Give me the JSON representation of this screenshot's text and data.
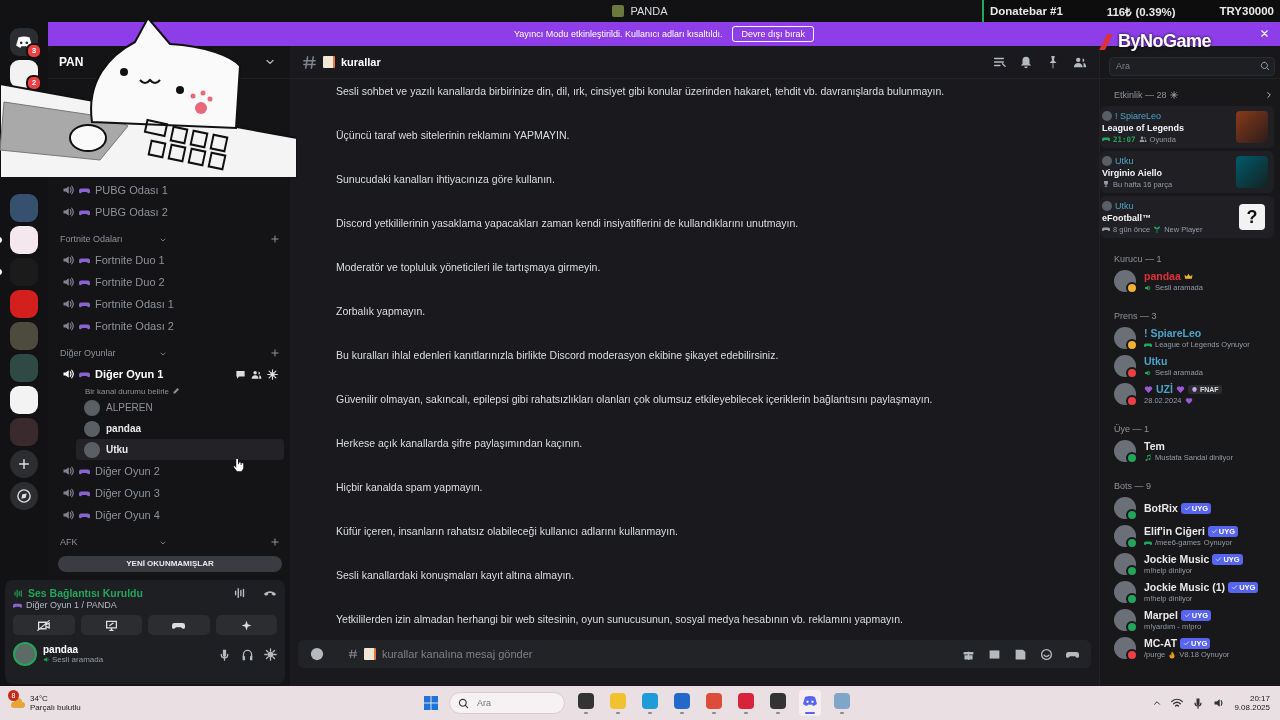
{
  "title_bar": {
    "title": "PANDA"
  },
  "donate_overlay": {
    "label": "Donatebar #1",
    "amount": "116₺ (0.39%)",
    "goal": "TRY30000"
  },
  "logo_overlay": {
    "text": "ByNoGame"
  },
  "banner": {
    "message": "Yayıncı Modu etkinleştirildi. Kullanıcı adları kısaltıldı.",
    "button": "Devre dışı bırak"
  },
  "servers": [
    {
      "kind": "home",
      "badge": "3",
      "unread": false
    },
    {
      "kind": "server",
      "badge": "2",
      "unread": false
    },
    {
      "kind": "gap"
    },
    {
      "kind": "server",
      "unread": false
    },
    {
      "kind": "server",
      "unread": true
    },
    {
      "kind": "server",
      "unread": true
    },
    {
      "kind": "server",
      "unread": false
    },
    {
      "kind": "server",
      "unread": false
    },
    {
      "kind": "server",
      "unread": false
    },
    {
      "kind": "server",
      "unread": false
    },
    {
      "kind": "server",
      "unread": false
    },
    {
      "kind": "add"
    },
    {
      "kind": "discover"
    }
  ],
  "sidebar": {
    "server_name": "PAN",
    "channels": [
      {
        "kind": "voice",
        "name": "PUBG Odası 1",
        "active": false
      },
      {
        "kind": "voice",
        "name": "PUBG Odası 2",
        "active": false
      },
      {
        "kind": "category",
        "name": "Fortnite Odaları",
        "children": [
          {
            "kind": "voice",
            "name": "Fortnite Duo 1",
            "active": false
          },
          {
            "kind": "voice",
            "name": "Fortnite Duo 2",
            "active": false
          },
          {
            "kind": "voice",
            "name": "Fortnite Odası 1",
            "active": false
          },
          {
            "kind": "voice",
            "name": "Fortnite Odası 2",
            "active": false
          }
        ]
      },
      {
        "kind": "category",
        "name": "Diğer Oyunlar",
        "children": [
          {
            "kind": "voice",
            "name": "Diğer Oyun 1",
            "active": true,
            "status": "Bir kanal durumu belirle",
            "users": [
              {
                "name": "ALPEREN",
                "dimmed": true,
                "hovered": false
              },
              {
                "name": "pandaa",
                "dimmed": false,
                "hovered": false
              },
              {
                "name": "Utku",
                "dimmed": false,
                "hovered": true
              }
            ]
          },
          {
            "kind": "voice",
            "name": "Diğer Oyun 2",
            "active": false
          },
          {
            "kind": "voice",
            "name": "Diğer Oyun 3",
            "active": false
          },
          {
            "kind": "voice",
            "name": "Diğer Oyun 4",
            "active": false
          }
        ]
      },
      {
        "kind": "category",
        "name": "AFK"
      }
    ],
    "unread_pill": "YENİ OKUNMAMIŞLAR"
  },
  "voice_panel": {
    "status": "Ses Bağlantısı Kuruldu",
    "channel": "Diğer Oyun 1 / PANDA"
  },
  "user_panel": {
    "name": "pandaa",
    "status": "Sesli aramada"
  },
  "chat": {
    "channel": "kurallar",
    "search": {
      "placeholder": "Ara"
    },
    "messages": [
      "Sesli sohbet ve yazılı kanallarda birbirinize din, dil, ırk, cinsiyet gibi konular üzerinden hakaret, tehdit vb. davranışlarda bulunmayın.",
      "Üçüncü taraf web sitelerinin reklamını YAPMAYIN.",
      "Sunucudaki kanalları ihtiyacınıza göre kullanın.",
      "Discord yetkililerinin yasaklama yapacakları zaman kendi insiyatiflerini de kullandıklarını unutmayın.",
      "Moderatör ve topluluk yöneticileri ile tartışmaya girmeyin.",
      "Zorbalık yapmayın.",
      "Bu kuralları ihlal edenleri kanıtlarınızla birlikte Discord moderasyon ekibine şikayet edebilirsiniz.",
      "Güvenilir olmayan, sakıncalı, epilepsi gibi rahatsızlıkları olanları çok olumsuz etkileyebilecek içeriklerin bağlantısını paylaşmayın.",
      "Herkese açık kanallarda şifre paylaşımından kaçının.",
      "Hiçbir kanalda spam yapmayın.",
      "Küfür içeren, insanların rahatsız olabileceği kullanıcı adlarını kullanmayın.",
      "Sesli kanallardaki konuşmaları kayıt altına almayın.",
      "Yetkililerden izin almadan herhangi bir web sitesinin, oyun sunucusunun, sosyal medya hesabının vb. reklamını yapmayın."
    ],
    "composer": {
      "placeholder": "kurallar kanalına mesaj gönder"
    }
  },
  "members": {
    "activity": {
      "title": "Etkinlik — 28",
      "cards": [
        {
          "user": "! SpiareLeo",
          "title": "League of Legends",
          "art": {
            "kind": "photo"
          },
          "meta": [
            {
              "kind": "timer",
              "text": "21:07"
            },
            {
              "kind": "players",
              "text": "Oyunda"
            }
          ]
        },
        {
          "user": "Utku",
          "title": "Virginio Aiello",
          "art": {
            "kind": "photo"
          },
          "meta": [
            {
              "kind": "trophy",
              "text": "Bu hafta 16 parça"
            }
          ]
        },
        {
          "user": "Utku",
          "title": "eFootball™",
          "art": {
            "kind": "mystery",
            "symbol": "?"
          },
          "meta": [
            {
              "kind": "gamepad",
              "text": "8 gün önce"
            },
            {
              "kind": "sprout",
              "text": "New Player"
            }
          ]
        }
      ]
    },
    "groups": [
      {
        "title": "Kurucu — 1",
        "members": [
          {
            "name": "pandaa",
            "color": "#e0313a",
            "status": {
              "color": "#f0b232"
            },
            "crown": true,
            "activity": {
              "kind": "voice",
              "text": "Sesli aramada"
            }
          }
        ]
      },
      {
        "title": "Prens — 3",
        "members": [
          {
            "name": "! SpiareLeo",
            "color": "#4aa3c8",
            "status": {
              "color": "#f0b232"
            },
            "activity": {
              "kind": "game",
              "text": "League of Legends Oynuyor"
            }
          },
          {
            "name": "Utku",
            "color": "#4aa3c8",
            "status": {
              "color": "#f23f43"
            },
            "activity": {
              "kind": "voice",
              "text": "Sesli aramada"
            }
          },
          {
            "name": "UZİ",
            "color": "#4aa3c8",
            "status": {
              "color": "#f23f43"
            },
            "hearts": true,
            "tag": "FNAF",
            "activity": {
              "kind": "date",
              "text": "28.02.2024"
            }
          }
        ]
      },
      {
        "title": "Üye — 1",
        "members": [
          {
            "name": "Tem",
            "color": "#e8e8ea",
            "status": {
              "color": "#23a55a"
            },
            "activity": {
              "kind": "music",
              "text": "Mustafa Sandal dinliyor"
            }
          }
        ]
      },
      {
        "title": "Bots — 9",
        "members": [
          {
            "name": "BotRix",
            "color": "#e8e8ea",
            "status": {
              "color": "#23a55a"
            },
            "bot_tag": "UYG"
          },
          {
            "name": "Elif'in Ciğeri",
            "color": "#e8e8ea",
            "status": {
              "color": "#23a55a"
            },
            "bot_tag": "UYG",
            "activity": {
              "kind": "game",
              "text": "/mee6-games",
              "extra": "Oynuyor"
            }
          },
          {
            "name": "Jockie Music",
            "color": "#e8e8ea",
            "status": {
              "color": "#23a55a"
            },
            "bot_tag": "UYG",
            "activity": {
              "kind": "plain",
              "text": "m!help dinliyor"
            }
          },
          {
            "name": "Jockie Music (1)",
            "color": "#e8e8ea",
            "status": {
              "color": "#23a55a"
            },
            "bot_tag": "UYG",
            "activity": {
              "kind": "plain",
              "text": "m!help dinliyor"
            }
          },
          {
            "name": "Marpel",
            "color": "#e8e8ea",
            "status": {
              "color": "#23a55a"
            },
            "bot_tag": "UYG",
            "activity": {
              "kind": "plain",
              "text": "m!yardım - m!pro"
            }
          },
          {
            "name": "MC-AT",
            "color": "#e8e8ea",
            "status": {
              "color": "#f23f43"
            },
            "bot_tag": "UYG",
            "activity": {
              "kind": "fire",
              "text": "/purge",
              "extra": "V8.18 Oynuyor"
            }
          }
        ]
      }
    ]
  },
  "taskbar": {
    "weather": {
      "badge": "8",
      "temp": "34°C",
      "desc": "Parçalı bulutlu"
    },
    "search": {
      "placeholder": "Ara"
    },
    "apps": [
      {
        "kind": "taskview",
        "active": false
      },
      {
        "kind": "files",
        "active": false
      },
      {
        "kind": "edge",
        "active": false
      },
      {
        "kind": "store",
        "active": false
      },
      {
        "kind": "chrome",
        "active": false
      },
      {
        "kind": "red",
        "active": false
      },
      {
        "kind": "dark",
        "active": false
      },
      {
        "kind": "discord",
        "active": true
      },
      {
        "kind": "gear",
        "active": false
      }
    ],
    "clock": {
      "time": "20:17",
      "date": "9.08.2025"
    }
  }
}
